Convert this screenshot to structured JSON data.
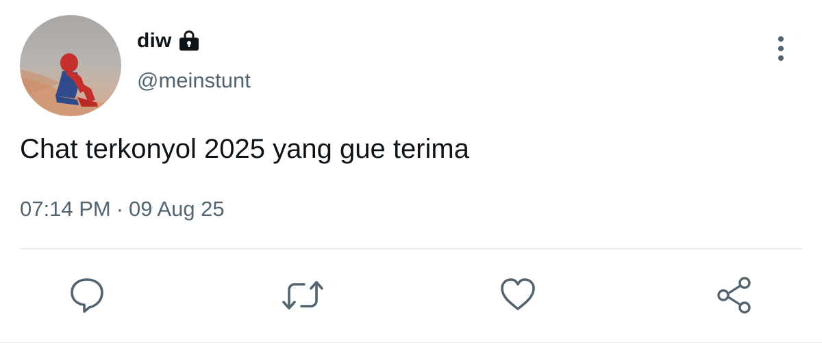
{
  "author": {
    "display_name": "diw",
    "handle": "@meinstunt",
    "protected": true
  },
  "tweet": {
    "text": "Chat terkonyol 2025 yang gue terima",
    "time": "07:14 PM",
    "separator": "·",
    "date": "09 Aug 25"
  },
  "icons": {
    "lock": "lock-icon",
    "more": "more-vertical-icon",
    "reply": "reply-icon",
    "retweet": "retweet-icon",
    "like": "heart-icon",
    "share": "share-icon"
  },
  "colors": {
    "text_primary": "#0f1419",
    "text_secondary": "#536471",
    "icon": "#536471",
    "divider": "#e6ecf0"
  }
}
